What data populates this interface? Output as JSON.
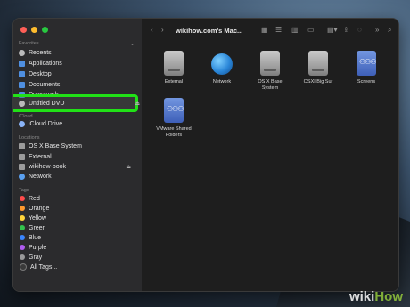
{
  "window": {
    "title": "wikihow.com's Mac..."
  },
  "sidebar": {
    "favorites_header": "Favorites",
    "favorites": [
      {
        "label": "Recents",
        "icon": "clock-icon"
      },
      {
        "label": "Applications",
        "icon": "applications-icon"
      },
      {
        "label": "Desktop",
        "icon": "desktop-icon"
      },
      {
        "label": "Documents",
        "icon": "document-icon"
      },
      {
        "label": "Downloads",
        "icon": "download-icon"
      },
      {
        "label": "Untitled DVD",
        "icon": "disc-icon"
      }
    ],
    "icloud_header": "iCloud",
    "icloud": [
      {
        "label": "iCloud Drive",
        "icon": "cloud-icon"
      }
    ],
    "locations_header": "Locations",
    "locations": [
      {
        "label": "OS X Base System",
        "icon": "disk-icon"
      },
      {
        "label": "External",
        "icon": "disk-icon"
      },
      {
        "label": "wikihow-book",
        "icon": "disk-icon"
      },
      {
        "label": "Network",
        "icon": "network-icon"
      }
    ],
    "tags_header": "Tags",
    "tags": [
      {
        "label": "Red",
        "color": "#ff4b4b"
      },
      {
        "label": "Orange",
        "color": "#ff9a2e"
      },
      {
        "label": "Yellow",
        "color": "#ffd43b"
      },
      {
        "label": "Green",
        "color": "#33c24d"
      },
      {
        "label": "Blue",
        "color": "#3a86ff"
      },
      {
        "label": "Purple",
        "color": "#b05cf0"
      },
      {
        "label": "Gray",
        "color": "#9a9a9a"
      },
      {
        "label": "All Tags...",
        "color": "#3a3a3a"
      }
    ]
  },
  "items": [
    {
      "label": "External",
      "icon": "hard-disk-icon"
    },
    {
      "label": "Network",
      "icon": "network-globe-icon"
    },
    {
      "label": "OS X Base System",
      "icon": "hard-disk-icon"
    },
    {
      "label": "OSXI Big Sur",
      "icon": "hard-disk-icon"
    },
    {
      "label": "Screens",
      "icon": "shared-screen-icon"
    },
    {
      "label": "VMware Shared Folders",
      "icon": "shared-folder-icon"
    }
  ],
  "watermark": {
    "part1": "wiki",
    "part2": "How"
  },
  "colors": {
    "highlight": "#21e117",
    "accent": "#4f8fe0"
  }
}
